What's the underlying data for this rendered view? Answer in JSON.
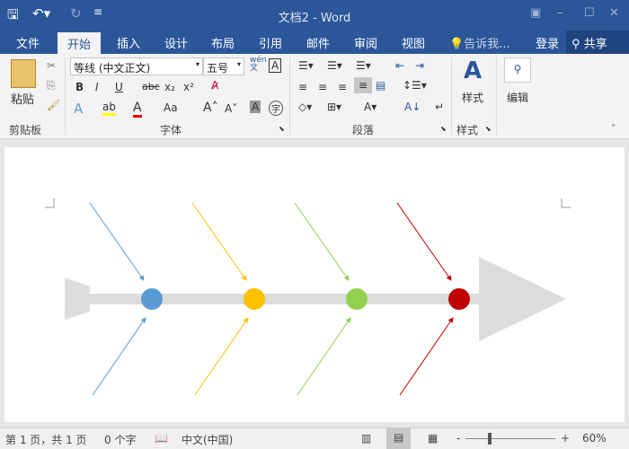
{
  "window": {
    "title": "文档2 - Word"
  },
  "tabs": [
    "文件",
    "开始",
    "插入",
    "设计",
    "布局",
    "引用",
    "邮件",
    "审阅",
    "视图"
  ],
  "tell_me": "告诉我...",
  "login": "登录",
  "share": "共享",
  "clipboard": {
    "paste": "粘贴",
    "group": "剪贴板"
  },
  "font": {
    "name": "等线 (中文正文)",
    "size": "五号",
    "group": "字体",
    "bold": "B",
    "italic": "I",
    "underline": "U",
    "strike": "abc",
    "sub": "x₂",
    "sup": "x²",
    "case": "Aa",
    "wen": "wén\n文",
    "boxA": "A"
  },
  "paragraph": {
    "group": "段落"
  },
  "styles": {
    "label": "样式",
    "group": "样式"
  },
  "editing": {
    "label": "编辑"
  },
  "status": {
    "page": "第 1 页，共 1 页",
    "words": "0 个字",
    "lang": "中文(中国)",
    "zoom": "60%"
  },
  "colors": {
    "blue": "#5b9bd5",
    "orange": "#ffc000",
    "green": "#92d050",
    "red": "#c00000",
    "brand": "#2b579a"
  }
}
